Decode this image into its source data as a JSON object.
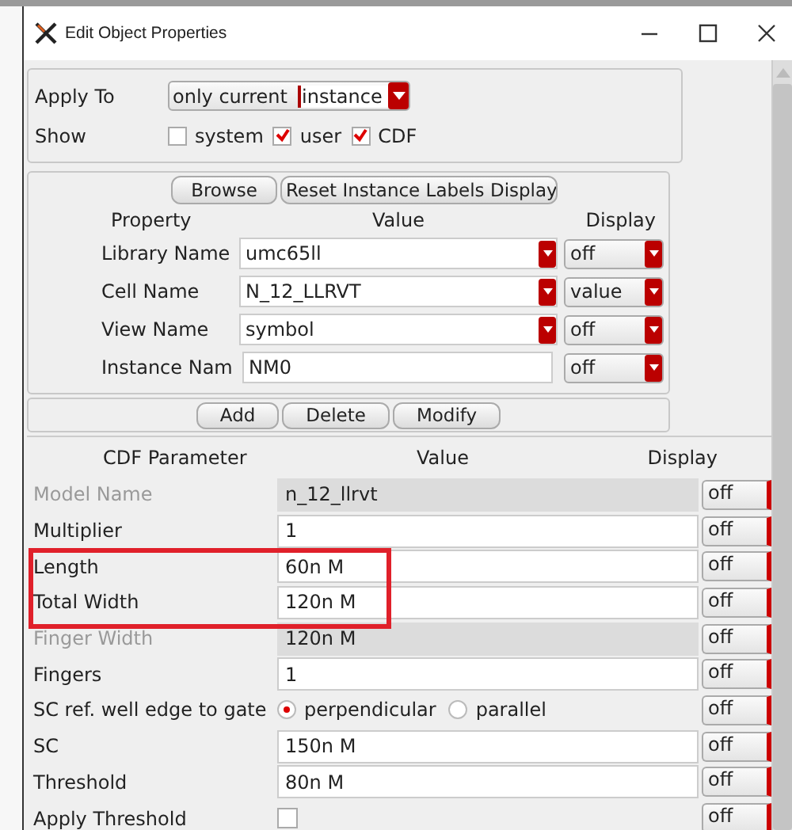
{
  "window": {
    "title": "Edit Object Properties"
  },
  "apply_to": {
    "label": "Apply To",
    "scope": "only current",
    "target": "instance"
  },
  "show": {
    "label": "Show",
    "options": [
      {
        "label": "system",
        "checked": false
      },
      {
        "label": "user",
        "checked": true
      },
      {
        "label": "CDF",
        "checked": true
      }
    ]
  },
  "top_buttons": [
    "Browse",
    "Reset Instance Labels Display"
  ],
  "property_columns": [
    "Property",
    "Value",
    "Display"
  ],
  "properties": [
    {
      "label": "Library Name",
      "kind": "combo",
      "value": "umc65ll",
      "display": "off"
    },
    {
      "label": "Cell Name",
      "kind": "combo",
      "value": "N_12_LLRVT",
      "display": "value"
    },
    {
      "label": "View Name",
      "kind": "combo",
      "value": "symbol",
      "display": "off"
    },
    {
      "label": "Instance Nam",
      "kind": "text",
      "value": "NM0",
      "display": "off"
    }
  ],
  "action_buttons": [
    "Add",
    "Delete",
    "Modify"
  ],
  "cdf_columns": [
    "CDF Parameter",
    "Value",
    "Display"
  ],
  "cdf_parameters": [
    {
      "label": "Model Name",
      "kind": "text",
      "value": "n_12_llrvt",
      "disabled": true,
      "highlighted": false,
      "display": "off"
    },
    {
      "label": "Multiplier",
      "kind": "text",
      "value": "1",
      "disabled": false,
      "highlighted": false,
      "display": "off"
    },
    {
      "label": "Length",
      "kind": "text",
      "value": "60n M",
      "disabled": false,
      "highlighted": true,
      "display": "off"
    },
    {
      "label": "Total Width",
      "kind": "text",
      "value": "120n M",
      "disabled": false,
      "highlighted": true,
      "display": "off"
    },
    {
      "label": "Finger Width",
      "kind": "text",
      "value": "120n M",
      "disabled": true,
      "highlighted": false,
      "display": "off"
    },
    {
      "label": "Fingers",
      "kind": "text",
      "value": "1",
      "disabled": false,
      "highlighted": false,
      "display": "off"
    },
    {
      "label": "SC ref. well edge to gate",
      "kind": "radio",
      "options": [
        {
          "label": "perpendicular",
          "selected": true
        },
        {
          "label": "parallel",
          "selected": false
        }
      ],
      "disabled": false,
      "highlighted": false,
      "display": "off"
    },
    {
      "label": "SC",
      "kind": "text",
      "value": "150n M",
      "disabled": false,
      "highlighted": false,
      "display": "off"
    },
    {
      "label": "Threshold",
      "kind": "text",
      "value": "80n M",
      "disabled": false,
      "highlighted": false,
      "display": "off"
    },
    {
      "label": "Apply Threshold",
      "kind": "checkbox",
      "checked": false,
      "disabled": false,
      "highlighted": false,
      "display": "off"
    }
  ]
}
